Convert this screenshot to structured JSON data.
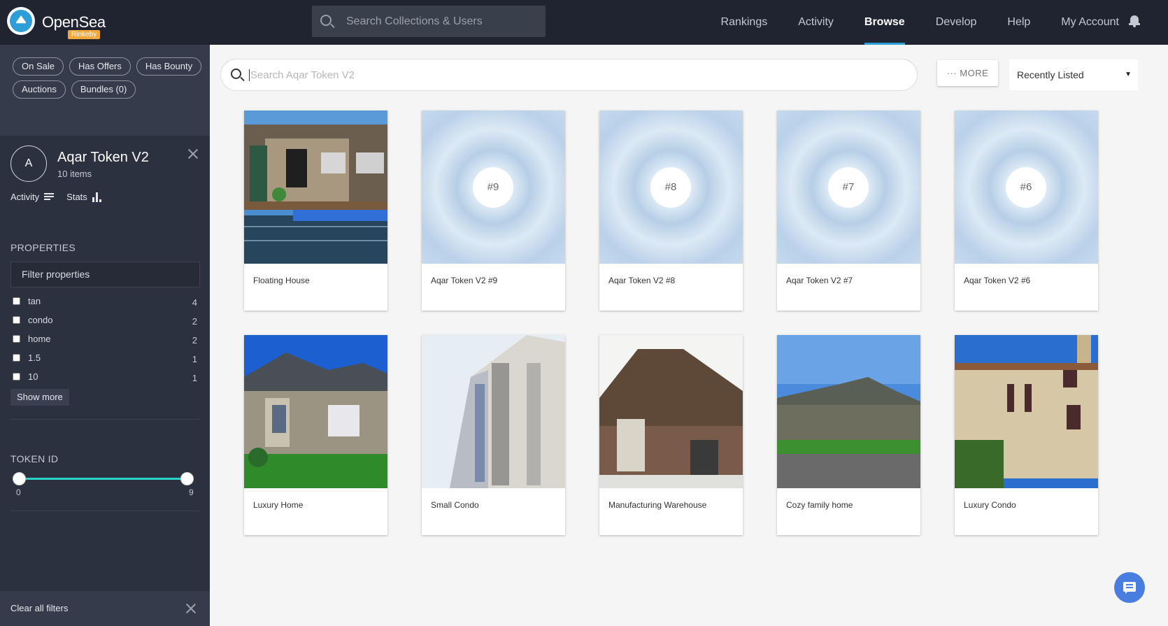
{
  "header": {
    "brand": "OpenSea",
    "network_badge": "Rinkeby",
    "search_placeholder": "Search Collections & Users",
    "nav": [
      "Rankings",
      "Activity",
      "Browse",
      "Develop",
      "Help",
      "My Account"
    ],
    "active_nav": "Browse"
  },
  "sidebar": {
    "chips": [
      "On Sale",
      "Has Offers",
      "Has Bounty",
      "Auctions",
      "Bundles (0)"
    ],
    "collection": {
      "avatar_letter": "A",
      "name": "Aqar Token V2",
      "count": "10 items",
      "tabs": [
        "Activity",
        "Stats"
      ]
    },
    "properties_title": "PROPERTIES",
    "filter_placeholder": "Filter properties",
    "properties": [
      {
        "label": "tan",
        "count": "4"
      },
      {
        "label": "condo",
        "count": "2"
      },
      {
        "label": "home",
        "count": "2"
      },
      {
        "label": "1.5",
        "count": "1"
      },
      {
        "label": "10",
        "count": "1"
      }
    ],
    "show_more": "Show more",
    "token_id_title": "TOKEN ID",
    "token_min": "0",
    "token_max": "9",
    "clear_filters": "Clear all filters"
  },
  "main": {
    "search_placeholder": "Search Aqar Token V2",
    "more_label": "··· MORE",
    "sort_value": "Recently Listed",
    "cards": [
      {
        "name": "Floating House",
        "image": "photo",
        "badge": ""
      },
      {
        "name": "Aqar Token V2 #9",
        "image": "placeholder",
        "badge": "#9"
      },
      {
        "name": "Aqar Token V2 #8",
        "image": "placeholder",
        "badge": "#8"
      },
      {
        "name": "Aqar Token V2 #7",
        "image": "placeholder",
        "badge": "#7"
      },
      {
        "name": "Aqar Token V2 #6",
        "image": "placeholder",
        "badge": "#6"
      },
      {
        "name": "Luxury Home",
        "image": "photo",
        "badge": ""
      },
      {
        "name": "Small Condo",
        "image": "photo",
        "badge": ""
      },
      {
        "name": "Manufacturing Warehouse",
        "image": "photo",
        "badge": ""
      },
      {
        "name": "Cozy family home",
        "image": "photo",
        "badge": ""
      },
      {
        "name": "Luxury Condo",
        "image": "photo",
        "badge": ""
      }
    ]
  },
  "colors": {
    "nav_bg": "#202431",
    "sidebar_bg": "#2b313f",
    "accent": "#2d9fd6",
    "slider": "#2ad3c7",
    "chat": "#4a7de0"
  }
}
